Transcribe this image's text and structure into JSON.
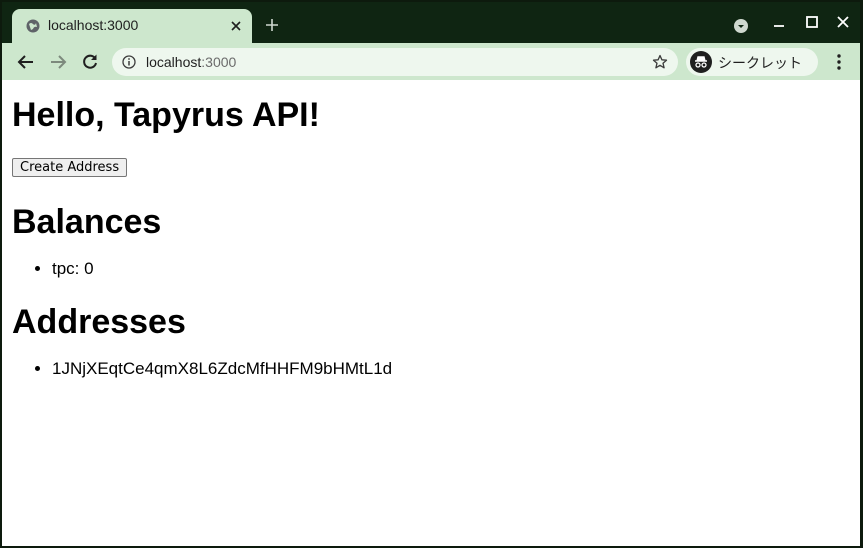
{
  "browser": {
    "tab": {
      "title": "localhost:3000"
    },
    "address_bar": {
      "host": "localhost",
      "port": ":3000"
    },
    "profile_label": "シークレット"
  },
  "page": {
    "heading": "Hello, Tapyrus API!",
    "create_button_label": "Create Address",
    "balances": {
      "heading": "Balances",
      "items": [
        "tpc: 0"
      ]
    },
    "addresses": {
      "heading": "Addresses",
      "items": [
        "1JNjXEqtCe4qmX8L6ZdcMfHHFM9bHMtL1d"
      ]
    }
  }
}
